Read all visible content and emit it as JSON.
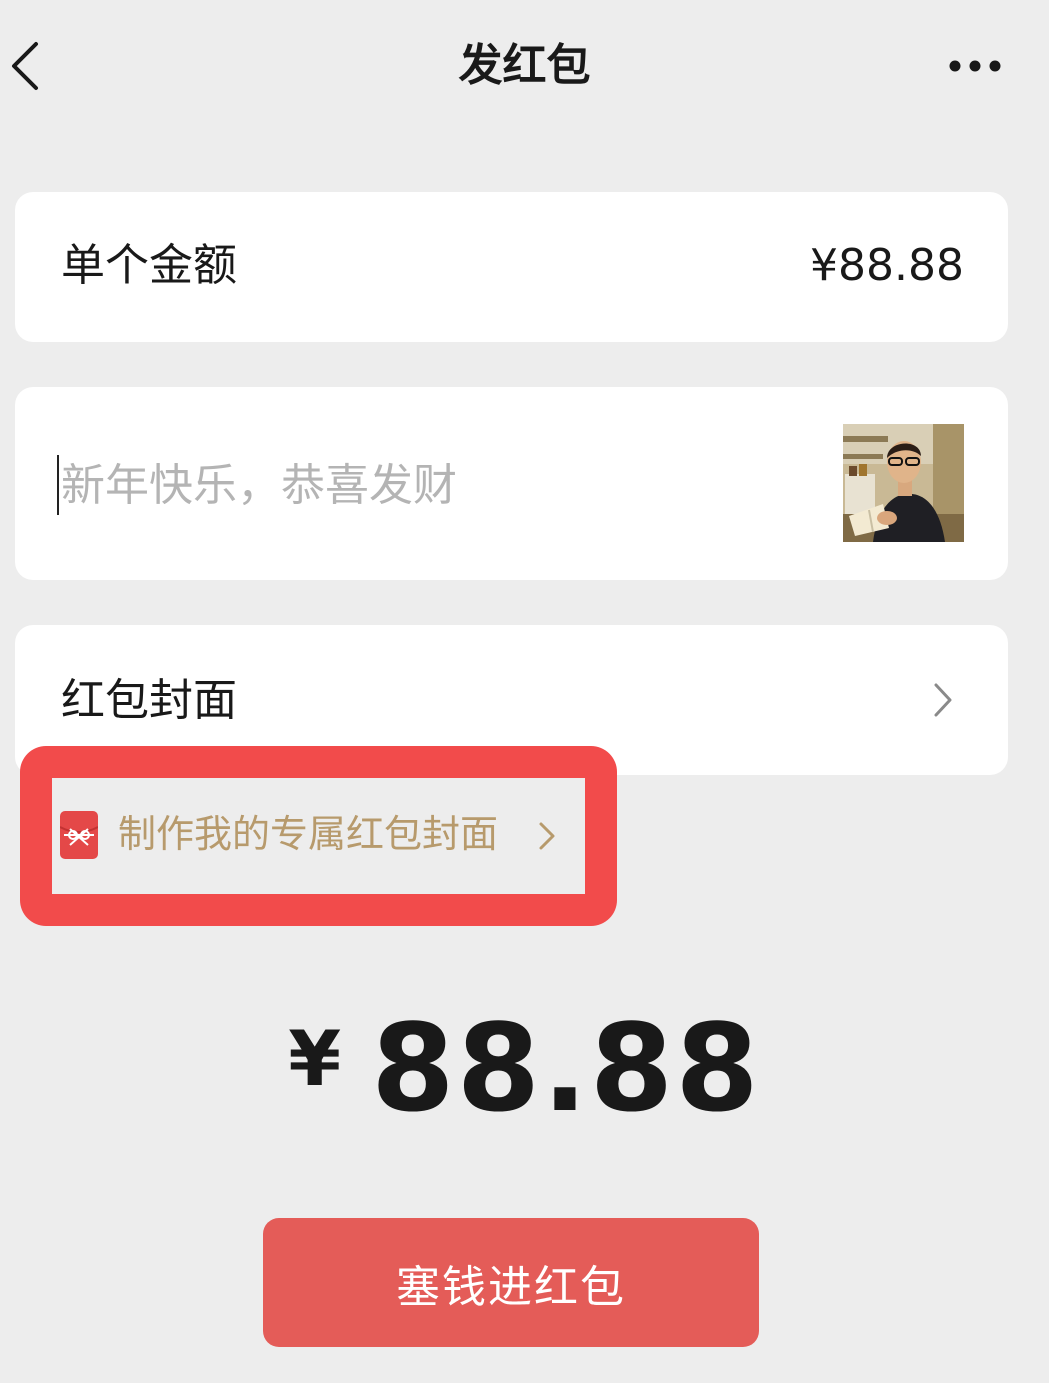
{
  "nav": {
    "title": "发红包",
    "back_icon": "chevron-left-icon",
    "more_icon": "more-dots-icon"
  },
  "amount_row": {
    "label": "单个金额",
    "value": "¥88.88"
  },
  "greeting_row": {
    "placeholder": "新年快乐，恭喜发财",
    "value": "",
    "thumbnail": "cover-thumbnail-photo"
  },
  "cover_row": {
    "label": "红包封面",
    "arrow_icon": "chevron-right-icon"
  },
  "custom_cover": {
    "text": "制作我的专属红包封面",
    "icon": "red-packet-icon",
    "arrow_icon": "chevron-right-icon"
  },
  "total": {
    "currency": "¥",
    "amount": "88.88"
  },
  "submit": {
    "label": "塞钱进红包"
  },
  "colors": {
    "background": "#ededed",
    "card": "#ffffff",
    "accent_gold": "#b79a6c",
    "highlight_red": "#f24b4b",
    "button_red": "#e45c58"
  }
}
